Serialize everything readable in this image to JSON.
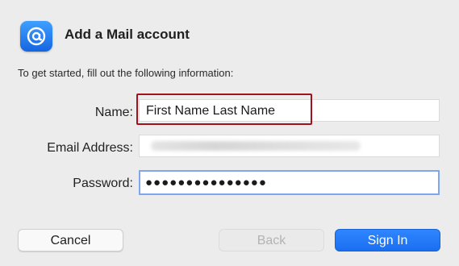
{
  "header": {
    "title": "Add a Mail account",
    "icon": "at-sign-icon"
  },
  "intro": "To get started, fill out the following information:",
  "form": {
    "name_label": "Name:",
    "name_value": "First Name Last Name",
    "email_label": "Email Address:",
    "email_value": "",
    "password_label": "Password:",
    "password_value": "●●●●●●●●●●●●●●●"
  },
  "buttons": {
    "cancel": "Cancel",
    "back": "Back",
    "sign_in": "Sign In"
  },
  "colors": {
    "accent": "#1a6ff0",
    "highlight_box": "#a3121c",
    "focus_ring": "#7fa6ee"
  }
}
